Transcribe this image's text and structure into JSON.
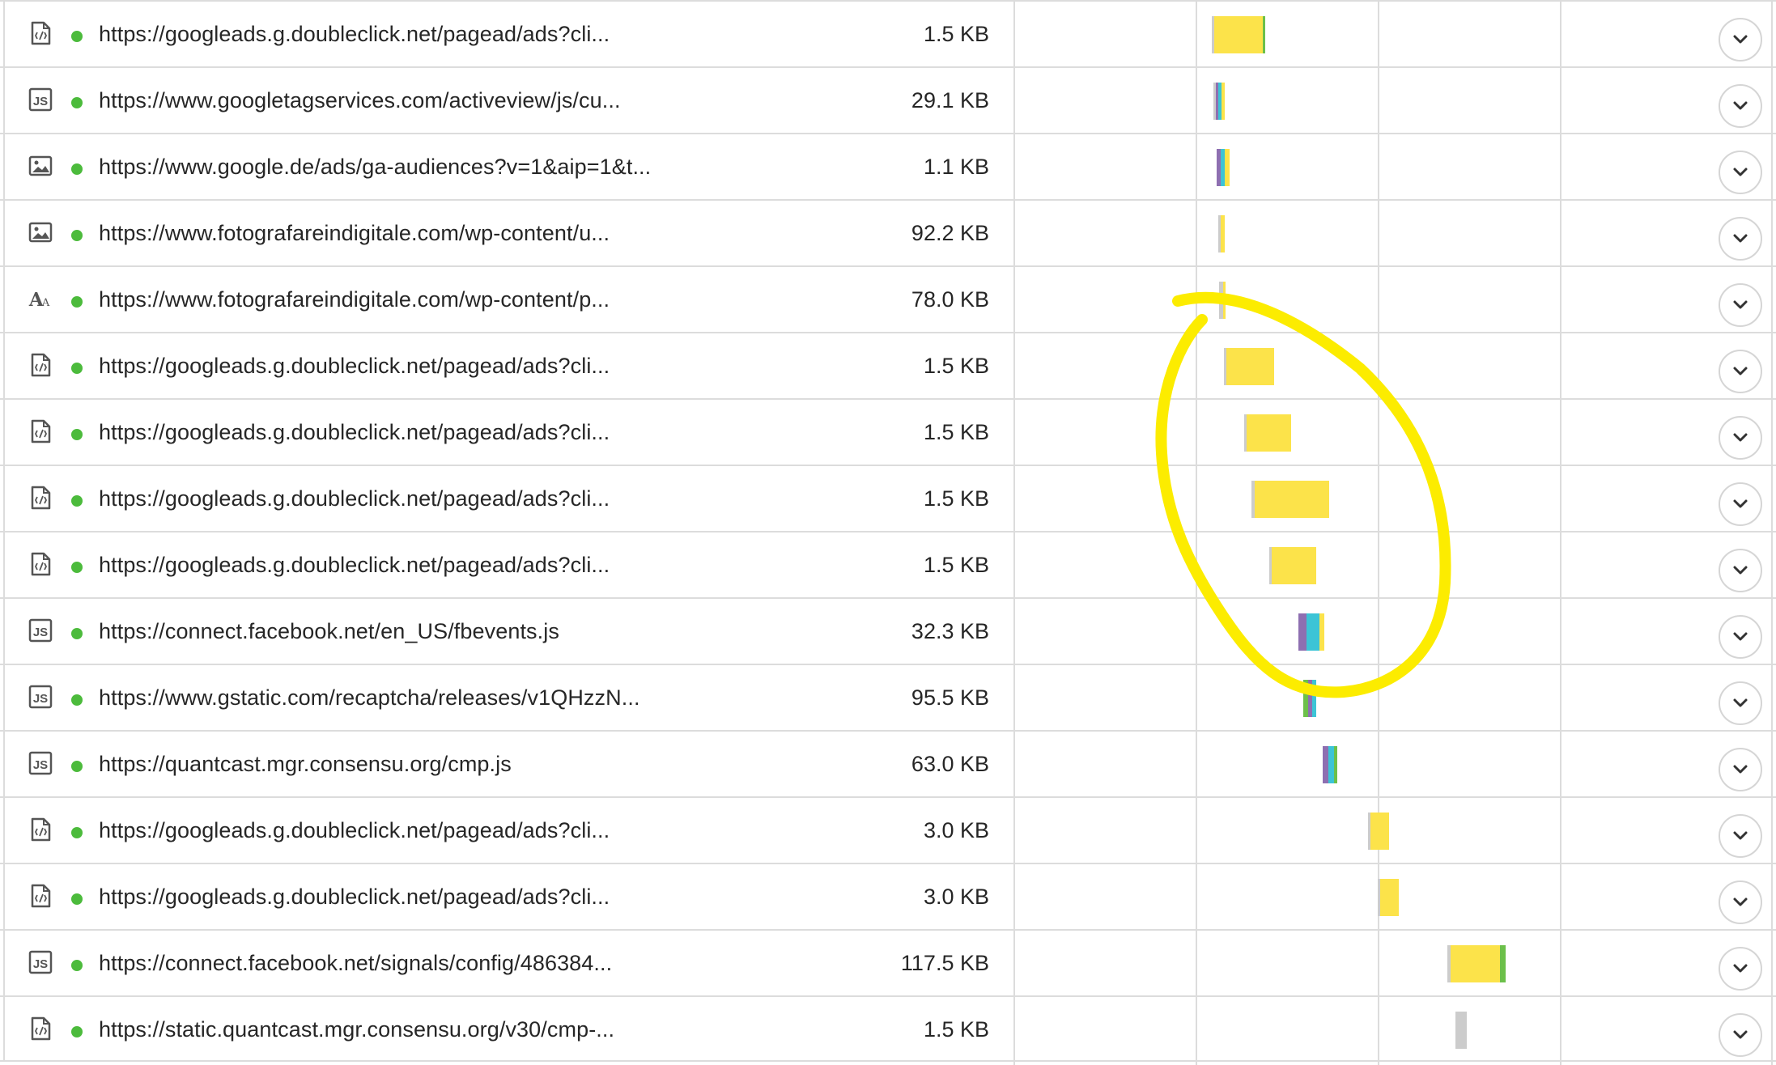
{
  "colors": {
    "status_ok": "#4cbb3c",
    "wait": "#fce34a",
    "dns": "#8e6fb1",
    "connect": "#3cc4d6",
    "ssl": "#6cc04a",
    "queued": "#cccccc",
    "annotation": "#fcec00"
  },
  "rows": [
    {
      "icon": "html-file-icon",
      "url": "https://googleads.g.doubleclick.net/pagead/ads?cli...",
      "size": "1.5 KB"
    },
    {
      "icon": "js-file-icon",
      "url": "https://www.googletagservices.com/activeview/js/cu...",
      "size": "29.1 KB"
    },
    {
      "icon": "image-file-icon",
      "url": "https://www.google.de/ads/ga-audiences?v=1&aip=1&t...",
      "size": "1.1 KB"
    },
    {
      "icon": "image-file-icon",
      "url": "https://www.fotografareindigitale.com/wp-content/u...",
      "size": "92.2 KB"
    },
    {
      "icon": "font-file-icon",
      "url": "https://www.fotografareindigitale.com/wp-content/p...",
      "size": "78.0 KB"
    },
    {
      "icon": "html-file-icon",
      "url": "https://googleads.g.doubleclick.net/pagead/ads?cli...",
      "size": "1.5 KB"
    },
    {
      "icon": "html-file-icon",
      "url": "https://googleads.g.doubleclick.net/pagead/ads?cli...",
      "size": "1.5 KB"
    },
    {
      "icon": "html-file-icon",
      "url": "https://googleads.g.doubleclick.net/pagead/ads?cli...",
      "size": "1.5 KB"
    },
    {
      "icon": "html-file-icon",
      "url": "https://googleads.g.doubleclick.net/pagead/ads?cli...",
      "size": "1.5 KB"
    },
    {
      "icon": "js-file-icon",
      "url": "https://connect.facebook.net/en_US/fbevents.js",
      "size": "32.3 KB"
    },
    {
      "icon": "js-file-icon",
      "url": "https://www.gstatic.com/recaptcha/releases/v1QHzzN...",
      "size": "95.5 KB"
    },
    {
      "icon": "js-file-icon",
      "url": "https://quantcast.mgr.consensu.org/cmp.js",
      "size": "63.0 KB"
    },
    {
      "icon": "html-file-icon",
      "url": "https://googleads.g.doubleclick.net/pagead/ads?cli...",
      "size": "3.0 KB"
    },
    {
      "icon": "html-file-icon",
      "url": "https://googleads.g.doubleclick.net/pagead/ads?cli...",
      "size": "3.0 KB"
    },
    {
      "icon": "js-file-icon",
      "url": "https://connect.facebook.net/signals/config/486384...",
      "size": "117.5 KB"
    },
    {
      "icon": "html-file-icon",
      "url": "https://static.quantcast.mgr.consensu.org/v30/cmp-...",
      "size": "1.5 KB"
    }
  ],
  "expand_icon": "chevron-down-icon"
}
